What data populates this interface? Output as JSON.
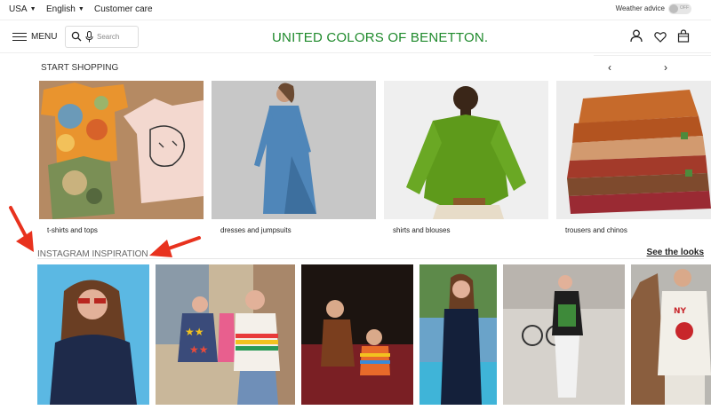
{
  "topbar": {
    "country": "USA",
    "language": "English",
    "customer_care": "Customer care",
    "weather_label": "Weather advice",
    "weather_toggle": "OFF"
  },
  "header": {
    "menu_label": "MENU",
    "search_placeholder": "Search",
    "logo": "UNITED COLORS OF BENETTON."
  },
  "start_shopping": {
    "title": "START SHOPPING",
    "categories": [
      {
        "label": "t-shirts and tops"
      },
      {
        "label": "dresses and jumpsuits"
      },
      {
        "label": "shirts and blouses"
      },
      {
        "label": "trousers and chinos"
      }
    ]
  },
  "instagram": {
    "title": "INSTAGRAM INSPIRATION",
    "see_looks": "See the looks"
  },
  "colors": {
    "brand_green": "#1f8a2c",
    "annotation_red": "#e8321e"
  },
  "icons": [
    "chevron-down-icon",
    "hamburger-icon",
    "search-icon",
    "microphone-icon",
    "user-icon",
    "heart-icon",
    "bag-icon",
    "chevron-left-icon",
    "chevron-right-icon"
  ]
}
